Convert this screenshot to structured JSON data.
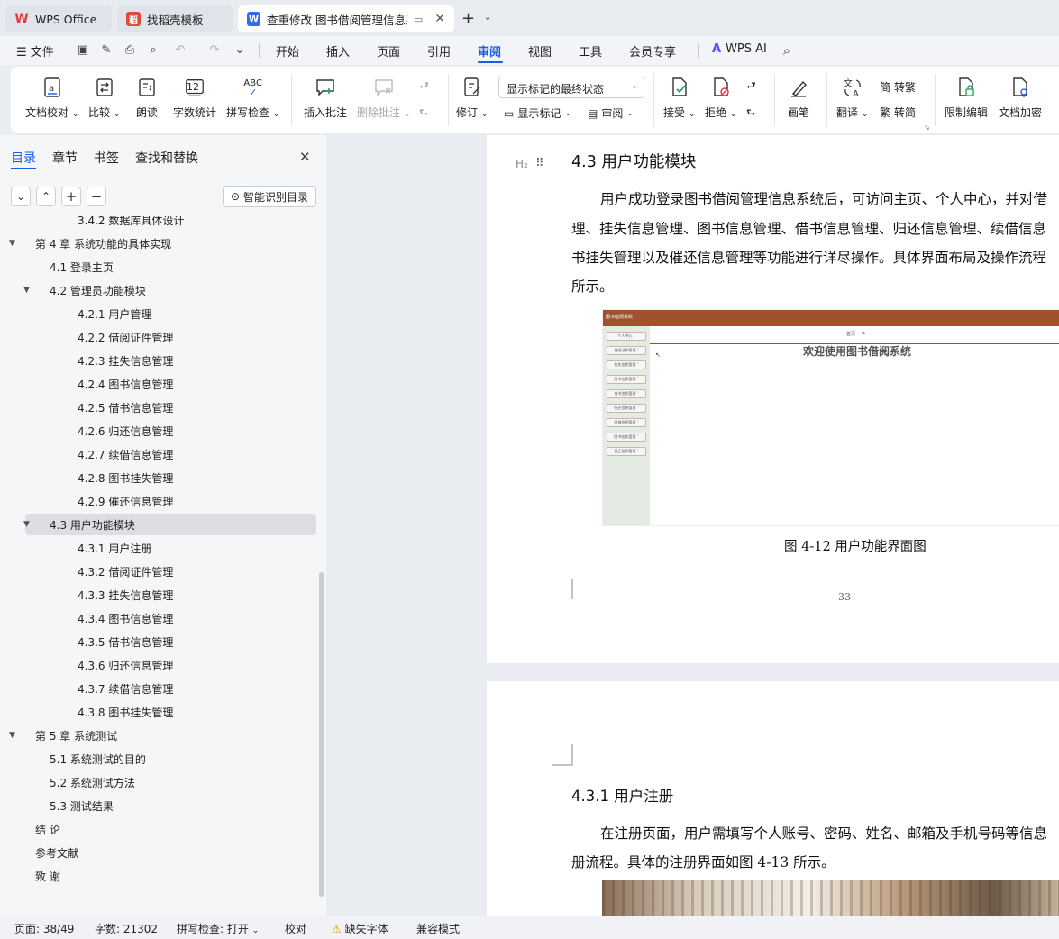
{
  "tabs": [
    {
      "label": "WPS Office",
      "icon": "wps-logo-icon"
    },
    {
      "label": "找稻壳模板",
      "icon": "docer-icon"
    },
    {
      "label": "查重修改 图书借阅管理信息系",
      "icon": "word-doc-icon"
    }
  ],
  "menu": {
    "file_label": "文件",
    "items": [
      "开始",
      "插入",
      "页面",
      "引用",
      "审阅",
      "视图",
      "工具",
      "会员专享"
    ],
    "active": "审阅",
    "ai_label": "WPS AI"
  },
  "ribbon": {
    "doc_check": "文档校对",
    "compare": "比较",
    "read_aloud": "朗读",
    "word_count": "字数统计",
    "spell_check": "拼写检查",
    "insert_comment": "插入批注",
    "delete_comment": "删除批注",
    "revise": "修订",
    "markup_state": "显示标记的最终状态",
    "show_markup": "显示标记",
    "review": "审阅",
    "accept": "接受",
    "reject": "拒绝",
    "pen": "画笔",
    "translate": "翻译",
    "to_traditional": "转繁",
    "to_simplified": "转简",
    "restrict_edit": "限制编辑",
    "doc_encrypt": "文档加密",
    "word_count_icon_text": "12",
    "spell_icon_text": "ABC"
  },
  "nav": {
    "tabs": [
      "目录",
      "章节",
      "书签",
      "查找和替换"
    ],
    "active_tab": "目录",
    "smart_toc": "智能识别目录",
    "toc": [
      {
        "label": "3.4.2 数据库具体设计",
        "level": 3,
        "arrow": ""
      },
      {
        "label": "第 4 章  系统功能的具体实现",
        "level": 1,
        "arrow": "▼"
      },
      {
        "label": "4.1 登录主页",
        "level": 2,
        "arrow": ""
      },
      {
        "label": "4.2 管理员功能模块",
        "level": 2,
        "arrow": "▼"
      },
      {
        "label": "4.2.1 用户管理",
        "level": 3,
        "arrow": ""
      },
      {
        "label": "4.2.2 借阅证件管理",
        "level": 3,
        "arrow": ""
      },
      {
        "label": "4.2.3 挂失信息管理",
        "level": 3,
        "arrow": ""
      },
      {
        "label": "4.2.4 图书信息管理",
        "level": 3,
        "arrow": ""
      },
      {
        "label": "4.2.5 借书信息管理",
        "level": 3,
        "arrow": ""
      },
      {
        "label": "4.2.6 归还信息管理",
        "level": 3,
        "arrow": ""
      },
      {
        "label": "4.2.7 续借信息管理",
        "level": 3,
        "arrow": ""
      },
      {
        "label": "4.2.8 图书挂失管理",
        "level": 3,
        "arrow": ""
      },
      {
        "label": "4.2.9 催还信息管理",
        "level": 3,
        "arrow": ""
      },
      {
        "label": "4.3 用户功能模块",
        "level": 2,
        "arrow": "▼",
        "selected": true
      },
      {
        "label": "4.3.1 用户注册",
        "level": 3,
        "arrow": ""
      },
      {
        "label": "4.3.2 借阅证件管理",
        "level": 3,
        "arrow": ""
      },
      {
        "label": "4.3.3 挂失信息管理",
        "level": 3,
        "arrow": ""
      },
      {
        "label": "4.3.4 图书信息管理",
        "level": 3,
        "arrow": ""
      },
      {
        "label": "4.3.5 借书信息管理",
        "level": 3,
        "arrow": ""
      },
      {
        "label": "4.3.6 归还信息管理",
        "level": 3,
        "arrow": ""
      },
      {
        "label": "4.3.7 续借信息管理",
        "level": 3,
        "arrow": ""
      },
      {
        "label": "4.3.8 图书挂失管理",
        "level": 3,
        "arrow": ""
      },
      {
        "label": "第 5 章  系统测试",
        "level": 1,
        "arrow": "▼"
      },
      {
        "label": "5.1 系统测试的目的",
        "level": 2,
        "arrow": ""
      },
      {
        "label": "5.2 系统测试方法",
        "level": 2,
        "arrow": ""
      },
      {
        "label": "5.3  测试结果",
        "level": 2,
        "arrow": ""
      },
      {
        "label": "结    论",
        "level": 1,
        "arrow": ""
      },
      {
        "label": "参考文献",
        "level": 1,
        "arrow": ""
      },
      {
        "label": "致    谢",
        "level": 1,
        "arrow": ""
      }
    ]
  },
  "doc": {
    "heading_marker": "H₂",
    "section_title": "4.3 用户功能模块",
    "para1_lines": [
      "用户成功登录图书借阅管理信息系统后，可访问主页、个人中心，并对借",
      "理、挂失信息管理、图书信息管理、借书信息管理、归还信息管理、续借信息",
      "书挂失管理以及催还信息管理等功能进行详尽操作。具体界面布局及操作流程",
      "所示。"
    ],
    "figure": {
      "app_title": "图书借阅系统",
      "welcome": "欢迎使用图书借阅系统",
      "top_links": [
        "首页",
        "⌂"
      ],
      "side_menu": [
        "个人中心 ˅",
        "借阅证件管理 ˅",
        "挂失信息管理 ˅",
        "图书信息管理 ˅",
        "借书信息管理 ˅",
        "归还信息管理 ˅",
        "续借信息管理 ˅",
        "图书挂失管理 ˅",
        "催还信息管理 ˅"
      ],
      "header_color": "#a0522d"
    },
    "caption": "图 4-12 用户功能界面图",
    "page_number": "33",
    "subsection_title": "4.3.1 用户注册",
    "para2_lines": [
      "在注册页面，用户需填写个人账号、密码、姓名、邮箱及手机号码等信息",
      "册流程。具体的注册界面如图 4-13 所示。"
    ]
  },
  "status": {
    "page": "页面: 38/49",
    "words": "字数: 21302",
    "spell": "拼写检查: 打开",
    "proof": "校对",
    "missing_font": "缺失字体",
    "compat": "兼容模式"
  },
  "colors": {
    "accent": "#1a5be6",
    "wps_red": "#e83a3a",
    "word_blue": "#2f6fed"
  }
}
